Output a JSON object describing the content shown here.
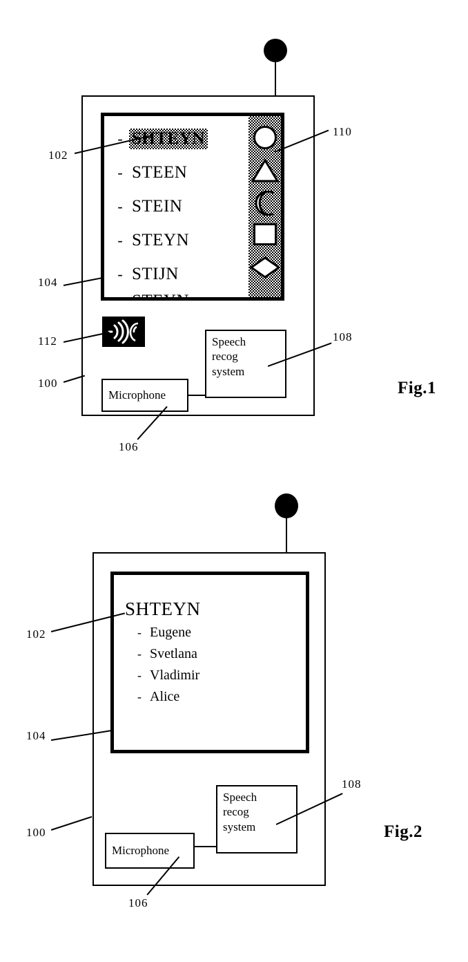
{
  "figures": [
    {
      "id": "fig1",
      "caption": "Fig.1",
      "screen": {
        "candidates": [
          {
            "dash": "-",
            "text": "SHTEYN",
            "selected": true
          },
          {
            "dash": "-",
            "text": "STEEN",
            "selected": false
          },
          {
            "dash": "-",
            "text": "STEIN",
            "selected": false
          },
          {
            "dash": "-",
            "text": "STEYN",
            "selected": false
          },
          {
            "dash": "-",
            "text": "STIJN",
            "selected": false
          },
          {
            "dash": "-",
            "text": "STEYN",
            "selected": false,
            "clipped": true
          }
        ],
        "icon_panel": {
          "shapes": [
            "circle",
            "triangle",
            "crescent",
            "square",
            "diamond"
          ]
        }
      },
      "audio_icon": "sound-into-ear-icon",
      "blocks": [
        {
          "key": "microphone",
          "label": "Microphone"
        },
        {
          "key": "speech_recog",
          "label": "Speech\nrecog\nsystem"
        }
      ],
      "refs": [
        {
          "num": "102",
          "target": "highlighted-candidate"
        },
        {
          "num": "104",
          "target": "display-screen"
        },
        {
          "num": "112",
          "target": "audio-icon"
        },
        {
          "num": "100",
          "target": "device-body"
        },
        {
          "num": "110",
          "target": "icon-panel"
        },
        {
          "num": "108",
          "target": "speech-recog-block"
        },
        {
          "num": "106",
          "target": "microphone-block"
        }
      ]
    },
    {
      "id": "fig2",
      "caption": "Fig.2",
      "screen": {
        "title": "SHTEYN",
        "entries": [
          {
            "dash": "-",
            "name": "Eugene"
          },
          {
            "dash": "-",
            "name": "Svetlana"
          },
          {
            "dash": "-",
            "name": "Vladimir"
          },
          {
            "dash": "-",
            "name": "Alice"
          }
        ]
      },
      "blocks": [
        {
          "key": "microphone",
          "label": "Microphone"
        },
        {
          "key": "speech_recog",
          "label": "Speech\nrecog\nsystem"
        }
      ],
      "refs": [
        {
          "num": "102",
          "target": "selected-name-title"
        },
        {
          "num": "104",
          "target": "display-screen"
        },
        {
          "num": "100",
          "target": "device-body"
        },
        {
          "num": "108",
          "target": "speech-recog-block"
        },
        {
          "num": "106",
          "target": "microphone-block"
        }
      ]
    }
  ],
  "text": {
    "microphone": "Microphone",
    "speech_line1": "Speech",
    "speech_line2": "recog",
    "speech_line3": "system",
    "fig1_caption": "Fig.1",
    "fig2_caption": "Fig.2",
    "f1_c0_dash": "-",
    "f1_c0_text": "SHTEYN",
    "f1_c1_dash": "-",
    "f1_c1_text": "STEEN",
    "f1_c2_dash": "-",
    "f1_c2_text": "STEIN",
    "f1_c3_dash": "-",
    "f1_c3_text": "STEYN",
    "f1_c4_dash": "-",
    "f1_c4_text": "STIJN",
    "f1_c5_dash": "-",
    "f1_c5_text": "STEYN",
    "f2_title": "SHTEYN",
    "f2_e0_dash": "-",
    "f2_e0_name": "Eugene",
    "f2_e1_dash": "-",
    "f2_e1_name": "Svetlana",
    "f2_e2_dash": "-",
    "f2_e2_name": "Vladimir",
    "f2_e3_dash": "-",
    "f2_e3_name": "Alice",
    "ref_100": "100",
    "ref_102": "102",
    "ref_104": "104",
    "ref_106": "106",
    "ref_108": "108",
    "ref_110": "110",
    "ref_112": "112"
  },
  "colors": {
    "ink": "#000000",
    "paper": "#ffffff",
    "dither": "#808080"
  }
}
